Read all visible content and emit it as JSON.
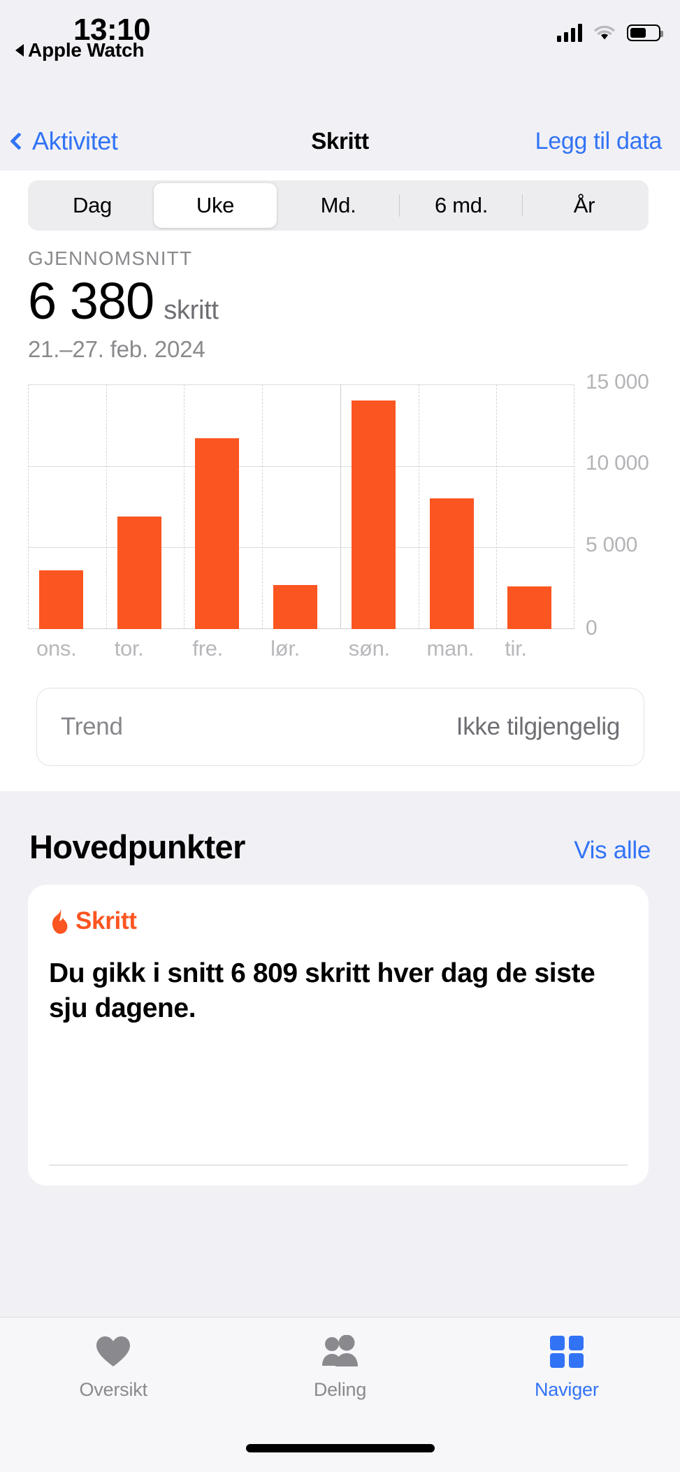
{
  "status_bar": {
    "time": "13:10",
    "back_app": "Apple Watch",
    "back_arrow_icon": "triangle-left-icon",
    "cellular_icon": "cellular-bars-icon",
    "wifi_icon": "wifi-icon",
    "battery_icon": "battery-icon"
  },
  "nav": {
    "back_label": "Aktivitet",
    "back_icon": "chevron-left-icon",
    "title": "Skritt",
    "action_label": "Legg til data"
  },
  "segmented": {
    "options": [
      "Dag",
      "Uke",
      "Md.",
      "6 md.",
      "År"
    ],
    "selected": "Uke"
  },
  "summary": {
    "label": "GJENNOMSNITT",
    "value": "6 380",
    "unit": "skritt",
    "range": "21.–27. feb. 2024"
  },
  "chart_data": {
    "type": "bar",
    "title": "",
    "xlabel": "",
    "ylabel": "",
    "categories": [
      "ons.",
      "tor.",
      "fre.",
      "lør.",
      "søn.",
      "man.",
      "tir."
    ],
    "values": [
      3600,
      6900,
      11700,
      2700,
      14000,
      8000,
      2600
    ],
    "series": [
      {
        "name": "Skritt",
        "values": [
          3600,
          6900,
          11700,
          2700,
          14000,
          8000,
          2600
        ]
      }
    ],
    "ylim": [
      0,
      15000
    ],
    "ytick_labels": [
      "15 000",
      "10 000",
      "5 000",
      "0"
    ],
    "yticks": [
      15000,
      10000,
      5000,
      0
    ],
    "grid": true,
    "legend": false,
    "bar_color": "#fb5521",
    "grid_color": "#dcdcdf"
  },
  "trend": {
    "label": "Trend",
    "value": "Ikke tilgjengelig"
  },
  "highlights": {
    "title": "Hovedpunkter",
    "see_all": "Vis alle",
    "card": {
      "kicker": "Skritt",
      "kicker_icon": "flame-icon",
      "body": "Du gikk i snitt 6 809 skritt hver dag de siste sju dagene."
    }
  },
  "tabbar": {
    "items": [
      {
        "label": "Oversikt",
        "icon": "heart-icon",
        "active": false
      },
      {
        "label": "Deling",
        "icon": "people-icon",
        "active": false
      },
      {
        "label": "Naviger",
        "icon": "grid-squares-icon",
        "active": true
      }
    ]
  },
  "colors": {
    "accent_blue": "#3273f6",
    "orange": "#fb5521",
    "gray_text": "#8a8a8e",
    "chrome_bg": "#f1f1f5"
  }
}
